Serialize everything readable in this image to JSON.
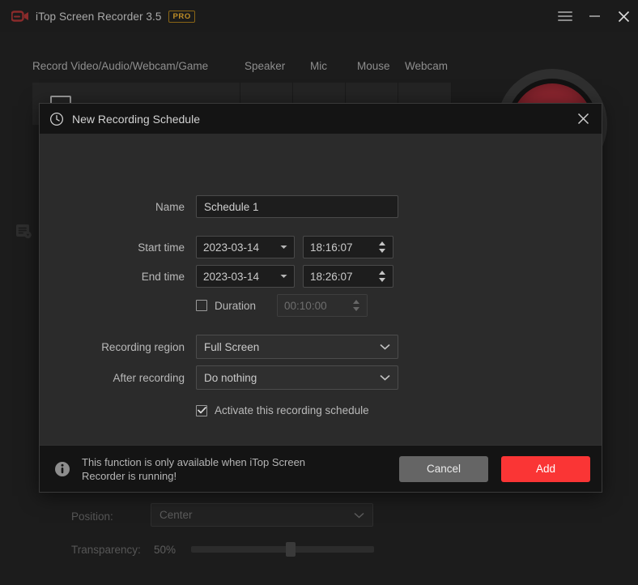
{
  "window": {
    "title": "iTop Screen Recorder 3.5",
    "badge": "PRO",
    "logo_icon": "video-camera-icon",
    "menu_icon": "hamburger-menu-icon",
    "minimize_icon": "minimize-icon",
    "close_icon": "close-icon"
  },
  "main": {
    "toolbar_labels": {
      "record": "Record Video/Audio/Webcam/Game",
      "speaker": "Speaker",
      "mic": "Mic",
      "mouse": "Mouse",
      "webcam": "Webcam"
    },
    "record_button_icon": "record-circle-icon",
    "rail_icon": "schedule-list-icon",
    "bottom": {
      "position_label": "Position:",
      "position_value": "Center",
      "transparency_label": "Transparency:",
      "transparency_value": "50%",
      "transparency_percent": 50
    }
  },
  "dialog": {
    "icon": "clock-icon",
    "title": "New Recording Schedule",
    "close_icon": "close-icon",
    "fields": {
      "name_label": "Name",
      "name_value": "Schedule 1",
      "name_placeholder": "Schedule 1",
      "start_label": "Start time",
      "start_date": "2023-03-14",
      "start_time": "18:16:07",
      "end_label": "End time",
      "end_date": "2023-03-14",
      "end_time": "18:26:07",
      "duration_label": "Duration",
      "duration_value": "00:10:00",
      "duration_checked": false,
      "region_label": "Recording region",
      "region_value": "Full Screen",
      "after_label": "After recording",
      "after_value": "Do nothing",
      "activate_label": "Activate this recording schedule",
      "activate_checked": true
    },
    "footer": {
      "info_icon": "info-icon",
      "message": "This function is only available when iTop Screen Recorder is running!",
      "cancel_label": "Cancel",
      "add_label": "Add"
    }
  },
  "colors": {
    "accent_red": "#fa3535",
    "dialog_bg": "#2b2b2b",
    "header_bg": "#141414",
    "app_bg": "#1c1c1c",
    "pro_gold": "#c08e26"
  }
}
